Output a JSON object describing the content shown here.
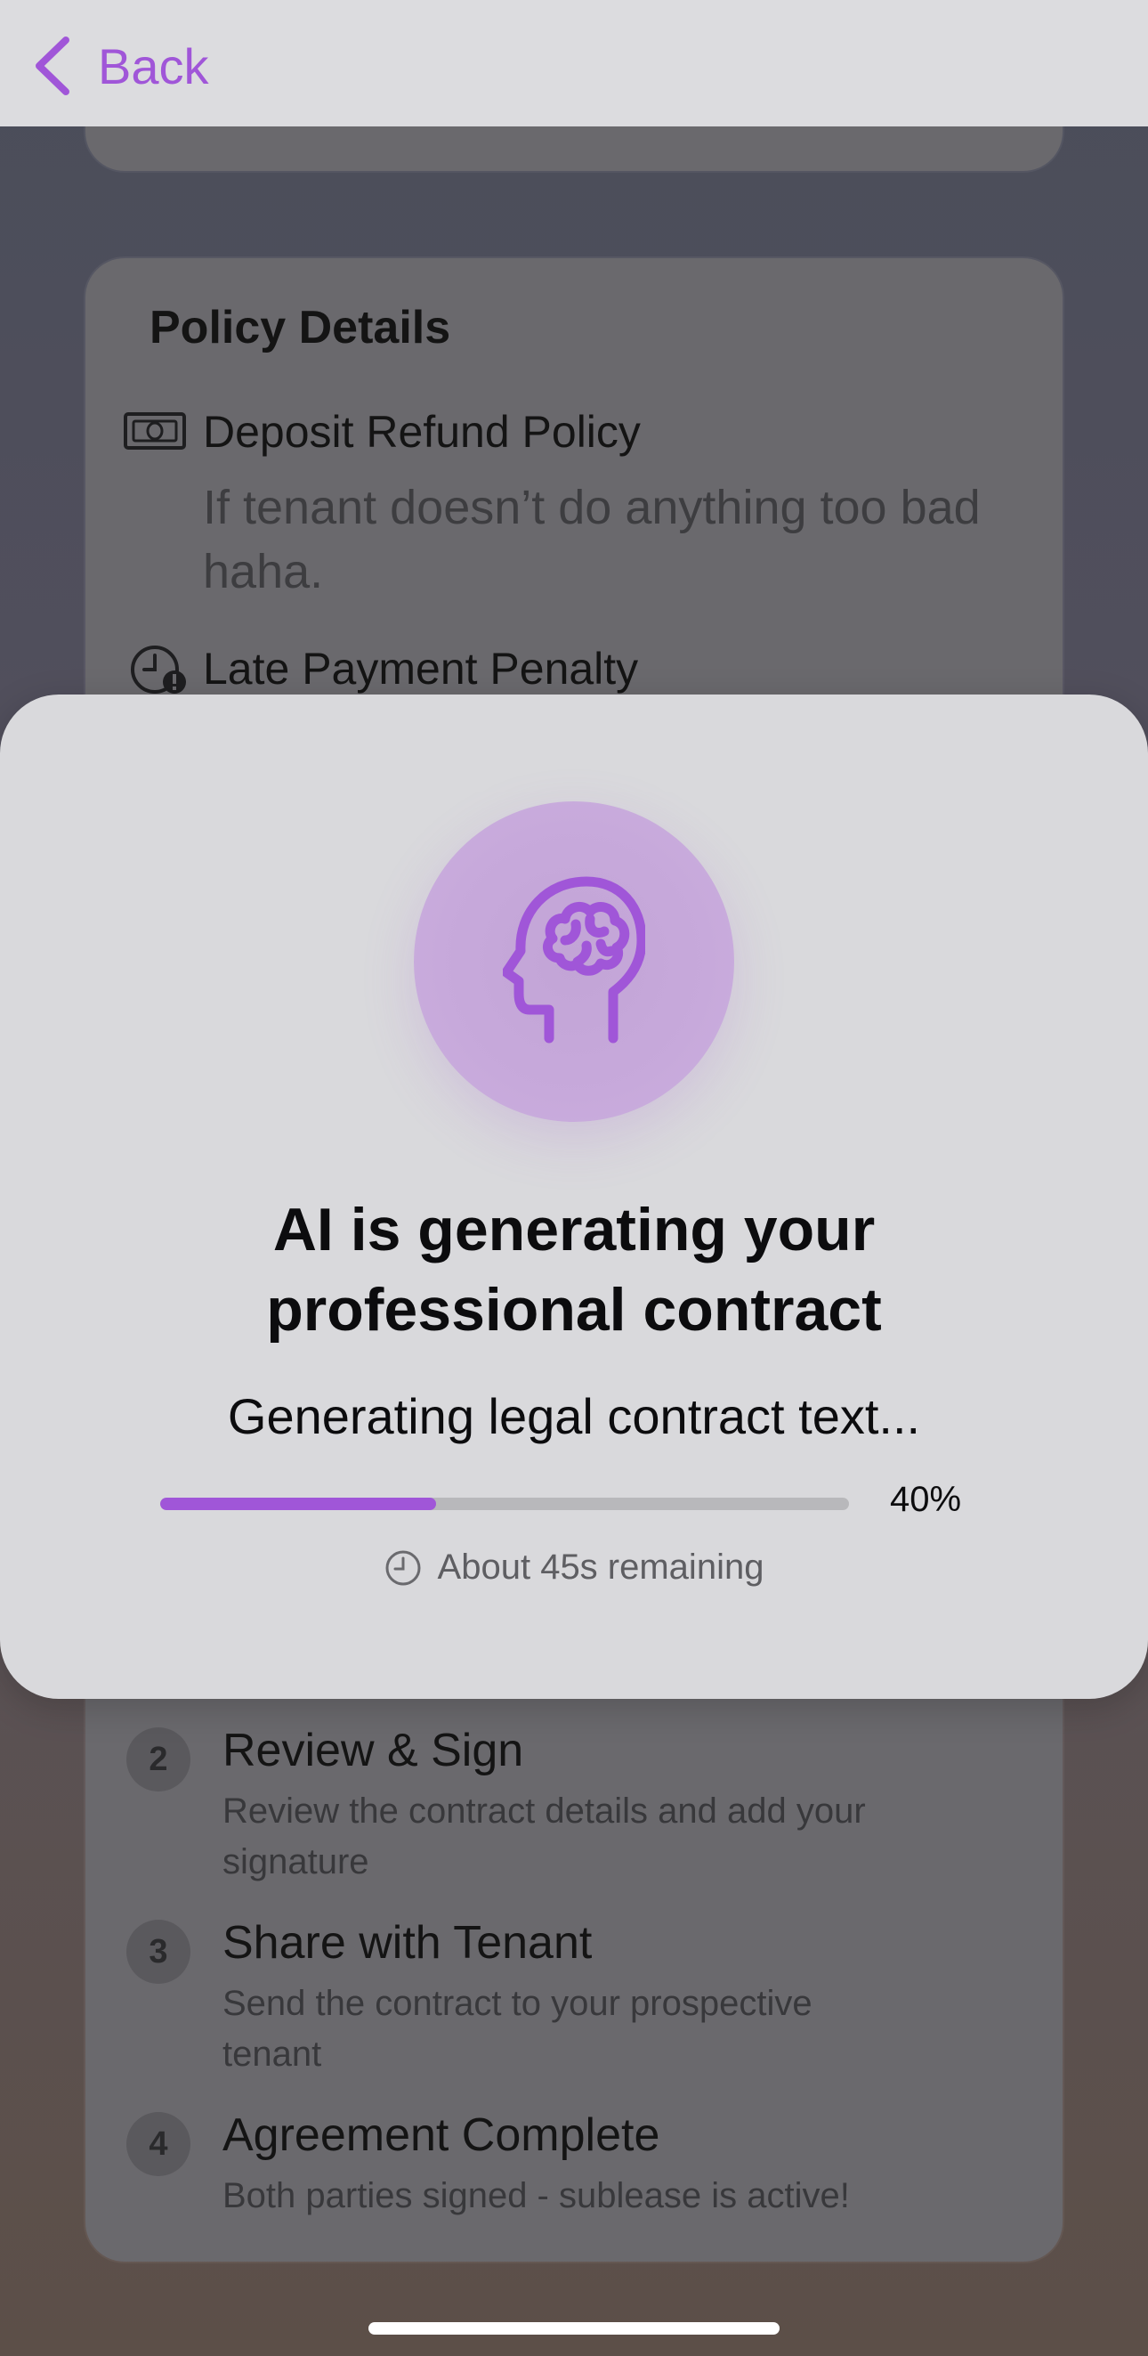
{
  "nav": {
    "back_label": "Back"
  },
  "policy": {
    "title": "Policy Details",
    "deposit_label": "Deposit Refund Policy",
    "deposit_value": "If tenant doesn’t do anything too bad haha.",
    "late_label": "Late Payment Penalty"
  },
  "steps": [
    {
      "number": "2",
      "title": "Review & Sign",
      "desc": "Review the contract details and add your signature"
    },
    {
      "number": "3",
      "title": "Share with Tenant",
      "desc": "Send the contract to your prospective tenant"
    },
    {
      "number": "4",
      "title": "Agreement Complete",
      "desc": "Both parties signed - sublease is active!"
    }
  ],
  "modal": {
    "title": "AI is generating your professional contract",
    "status": "Generating legal contract text...",
    "progress": 0.4,
    "progress_label": "40%",
    "remaining": "About 45s remaining"
  },
  "colors": {
    "accent": "#a056d8",
    "modal_bg": "#d9d9dc"
  },
  "icons": {
    "back": "chevron-left-icon",
    "deposit": "banknote-icon",
    "late": "clock-alert-icon",
    "hero": "brain-head-icon",
    "remaining": "clock-icon"
  }
}
